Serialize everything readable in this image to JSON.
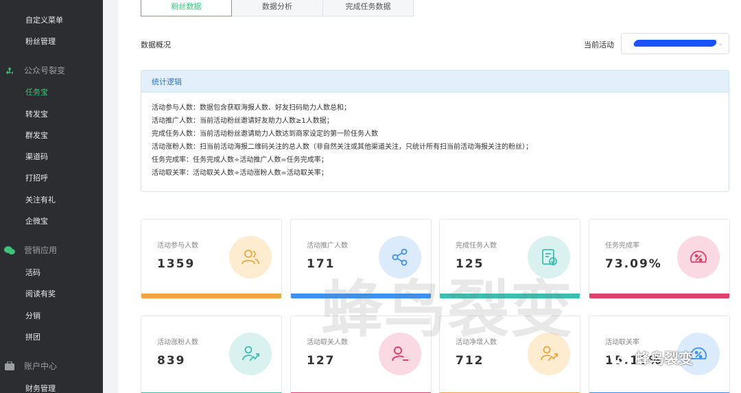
{
  "sidebar": {
    "top_items": [
      {
        "label": "自定义菜单"
      },
      {
        "label": "粉丝管理"
      }
    ],
    "groups": [
      {
        "label": "公众号裂变",
        "icon": "recycle-icon",
        "items": [
          {
            "label": "任务宝",
            "active": true
          },
          {
            "label": "转发宝"
          },
          {
            "label": "群发宝"
          },
          {
            "label": "渠道码"
          },
          {
            "label": "打招呼"
          },
          {
            "label": "关注有礼"
          },
          {
            "label": "企微宝"
          }
        ]
      },
      {
        "label": "营销应用",
        "icon": "wechat-icon",
        "items": [
          {
            "label": "活码"
          },
          {
            "label": "阅读有奖"
          },
          {
            "label": "分销"
          },
          {
            "label": "拼团"
          }
        ]
      },
      {
        "label": "账户中心",
        "icon": "briefcase-icon",
        "items": [
          {
            "label": "财务管理"
          }
        ]
      }
    ]
  },
  "tabs": [
    {
      "label": "粉丝数据",
      "active": true
    },
    {
      "label": "数据分析"
    },
    {
      "label": "完成任务数据"
    }
  ],
  "overview": {
    "title": "数据概况"
  },
  "activity_select": {
    "label": "当前活动",
    "value": ""
  },
  "logic": {
    "title": "统计逻辑",
    "lines": [
      "活动参与人数：数据包含获取海报人数、好友扫码助力人数总和；",
      "活动推广人数：当前活动粉丝邀请好友助力人数≥1人数据；",
      "完成任务人数：当前活动粉丝邀请助力人数达到商家设定的第一阶任务人数",
      "活动涨粉人数：扫当前活动海报二维码关注的总人数（非自然关注或其他渠道关注，只统计所有扫当前活动海报关注的粉丝）；",
      "任务完成率：任务完成人数÷活动推广人数=任务完成率；",
      "活动取关率：活动取关人数÷活动涨粉人数=活动取关率；"
    ]
  },
  "cards": [
    {
      "label": "活动参与人数",
      "value": "1359",
      "icon": "users-icon",
      "icon_bg": "#fdeccf",
      "icon_color": "#f0a640",
      "bar_color": "#f0a640"
    },
    {
      "label": "活动推广人数",
      "value": "171",
      "icon": "share-icon",
      "icon_bg": "#dbebfc",
      "icon_color": "#3d8ff0",
      "bar_color": "#3d8ff0"
    },
    {
      "label": "完成任务人数",
      "value": "125",
      "icon": "task-check-icon",
      "icon_bg": "#d9f2ef",
      "icon_color": "#3dbdb0",
      "bar_color": "#3dbdb0"
    },
    {
      "label": "任务完成率",
      "value": "73.09%",
      "icon": "gauge-icon",
      "icon_bg": "#fbd9e2",
      "icon_color": "#e0406a",
      "bar_color": "#e0406a"
    },
    {
      "label": "活动涨粉人数",
      "value": "839",
      "icon": "user-growth-icon",
      "icon_bg": "#d9f2ef",
      "icon_color": "#3dbdb0",
      "bar_color": "#3dbdb0"
    },
    {
      "label": "活动取关人数",
      "value": "127",
      "icon": "user-minus-icon",
      "icon_bg": "#fbd9e2",
      "icon_color": "#e0406a",
      "bar_color": "#e0406a"
    },
    {
      "label": "活动净增人数",
      "value": "712",
      "icon": "user-growth-icon",
      "icon_bg": "#fdeccf",
      "icon_color": "#f0a640",
      "bar_color": "#f0a640"
    },
    {
      "label": "活动取关率",
      "value": "15.13%",
      "icon": "gauge-icon",
      "icon_bg": "#dbebfc",
      "icon_color": "#3d8ff0",
      "bar_color": "#3d8ff0"
    }
  ],
  "watermark": {
    "text": "蜂鸟裂变"
  },
  "corner_mark": {
    "text": "蜂鸟裂变",
    "icon": "wechat-official-account-icon"
  },
  "colors": {
    "accent": "#3fc27a",
    "sidebar_bg": "#2b2d30",
    "logic_header_bg": "#e3f0fb"
  }
}
